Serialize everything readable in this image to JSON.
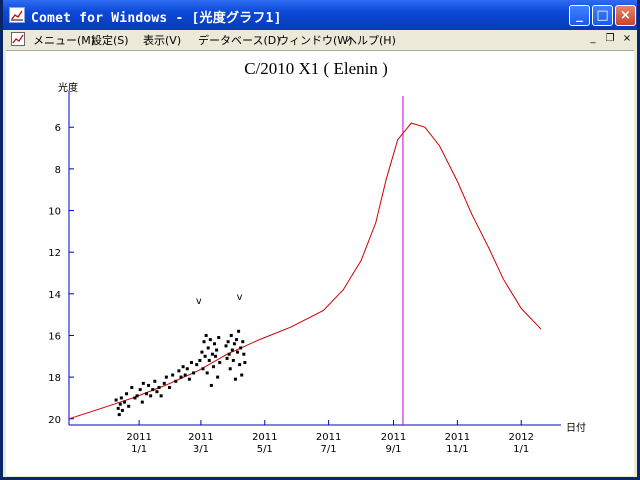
{
  "window": {
    "title": "Comet for Windows - [光度グラフ1]",
    "icon_name": "app-graph-icon",
    "minimize_icon": "minimize-icon",
    "maximize_icon": "maximize-icon",
    "close_icon": "close-icon"
  },
  "menu": {
    "items": [
      "メニュー(M)",
      "設定(S)",
      "表示(V)",
      "データベース(D)",
      "ウィンドウ(W)",
      "ヘルプ(H)"
    ]
  },
  "chart_data": {
    "type": "scatter",
    "title": "C/2010 X1 ( Elenin )",
    "ylabel": "光度",
    "xlabel": "日付",
    "y_ticks": [
      6,
      8,
      10,
      12,
      14,
      16,
      18,
      20
    ],
    "ylim": [
      20.3,
      4.5
    ],
    "y_inverted": true,
    "x_tick_labels": [
      {
        "date": "2011-01-01",
        "year": "2011",
        "md": "1/1"
      },
      {
        "date": "2011-03-01",
        "year": "2011",
        "md": "3/1"
      },
      {
        "date": "2011-05-01",
        "year": "2011",
        "md": "5/1"
      },
      {
        "date": "2011-07-01",
        "year": "2011",
        "md": "7/1"
      },
      {
        "date": "2011-09-01",
        "year": "2011",
        "md": "9/1"
      },
      {
        "date": "2011-11-01",
        "year": "2011",
        "md": "11/1"
      },
      {
        "date": "2012-01-01",
        "year": "2012",
        "md": "1/1"
      }
    ],
    "xlim": [
      "2010-10-26",
      "2012-02-08"
    ],
    "today_marker_date": "2011-09-10",
    "predicted_curve": {
      "color": "#cc0000",
      "points": [
        [
          "2010-10-26",
          20.0
        ],
        [
          "2010-11-26",
          19.5
        ],
        [
          "2010-12-26",
          19.0
        ],
        [
          "2011-01-26",
          18.4
        ],
        [
          "2011-02-26",
          17.7
        ],
        [
          "2011-03-26",
          16.9
        ],
        [
          "2011-04-26",
          16.2
        ],
        [
          "2011-05-26",
          15.6
        ],
        [
          "2011-06-26",
          14.8
        ],
        [
          "2011-07-15",
          13.8
        ],
        [
          "2011-08-01",
          12.4
        ],
        [
          "2011-08-15",
          10.6
        ],
        [
          "2011-08-25",
          8.5
        ],
        [
          "2011-09-05",
          6.6
        ],
        [
          "2011-09-18",
          5.8
        ],
        [
          "2011-10-01",
          6.0
        ],
        [
          "2011-10-15",
          6.9
        ],
        [
          "2011-11-01",
          8.6
        ],
        [
          "2011-11-15",
          10.2
        ],
        [
          "2011-12-01",
          11.8
        ],
        [
          "2011-12-15",
          13.3
        ],
        [
          "2012-01-01",
          14.7
        ],
        [
          "2012-01-20",
          15.7
        ]
      ]
    },
    "observations": [
      [
        "2010-12-10",
        19.1
      ],
      [
        "2010-12-12",
        19.5
      ],
      [
        "2010-12-13",
        19.8
      ],
      [
        "2010-12-14",
        19.3
      ],
      [
        "2010-12-15",
        19.0
      ],
      [
        "2010-12-16",
        19.6
      ],
      [
        "2010-12-18",
        19.2
      ],
      [
        "2010-12-20",
        18.8
      ],
      [
        "2010-12-22",
        19.4
      ],
      [
        "2010-12-25",
        18.5
      ],
      [
        "2010-12-28",
        19.0
      ],
      [
        "2010-12-30",
        18.9
      ],
      [
        "2011-01-02",
        18.6
      ],
      [
        "2011-01-04",
        19.2
      ],
      [
        "2011-01-05",
        18.3
      ],
      [
        "2011-01-08",
        18.8
      ],
      [
        "2011-01-10",
        18.4
      ],
      [
        "2011-01-12",
        18.9
      ],
      [
        "2011-01-14",
        18.6
      ],
      [
        "2011-01-16",
        18.2
      ],
      [
        "2011-01-18",
        18.7
      ],
      [
        "2011-01-20",
        18.5
      ],
      [
        "2011-01-22",
        18.9
      ],
      [
        "2011-01-25",
        18.3
      ],
      [
        "2011-01-27",
        18.0
      ],
      [
        "2011-01-30",
        18.5
      ],
      [
        "2011-02-02",
        17.9
      ],
      [
        "2011-02-05",
        18.2
      ],
      [
        "2011-02-08",
        17.7
      ],
      [
        "2011-02-10",
        18.0
      ],
      [
        "2011-02-12",
        17.5
      ],
      [
        "2011-02-14",
        17.9
      ],
      [
        "2011-02-16",
        17.6
      ],
      [
        "2011-02-18",
        18.1
      ],
      [
        "2011-02-20",
        17.3
      ],
      [
        "2011-02-22",
        17.8
      ],
      [
        "2011-02-25",
        17.4
      ],
      [
        "2011-02-28",
        17.2
      ],
      [
        "2011-03-02",
        16.8
      ],
      [
        "2011-03-03",
        17.6
      ],
      [
        "2011-03-04",
        16.3
      ],
      [
        "2011-03-05",
        17.0
      ],
      [
        "2011-03-06",
        16.0
      ],
      [
        "2011-03-07",
        17.8
      ],
      [
        "2011-03-08",
        16.6
      ],
      [
        "2011-03-09",
        17.2
      ],
      [
        "2011-03-10",
        16.2
      ],
      [
        "2011-03-11",
        18.4
      ],
      [
        "2011-03-12",
        16.9
      ],
      [
        "2011-03-13",
        17.5
      ],
      [
        "2011-03-14",
        16.4
      ],
      [
        "2011-03-15",
        17.0
      ],
      [
        "2011-03-16",
        16.7
      ],
      [
        "2011-03-17",
        18.0
      ],
      [
        "2011-03-18",
        16.1
      ],
      [
        "2011-03-19",
        17.3
      ],
      [
        "2011-03-25",
        16.5
      ],
      [
        "2011-03-26",
        17.1
      ],
      [
        "2011-03-27",
        16.3
      ],
      [
        "2011-03-28",
        16.9
      ],
      [
        "2011-03-29",
        17.6
      ],
      [
        "2011-03-30",
        16.0
      ],
      [
        "2011-03-31",
        16.7
      ],
      [
        "2011-04-01",
        17.2
      ],
      [
        "2011-04-02",
        16.4
      ],
      [
        "2011-04-03",
        18.1
      ],
      [
        "2011-04-04",
        16.2
      ],
      [
        "2011-04-05",
        16.8
      ],
      [
        "2011-04-06",
        15.8
      ],
      [
        "2011-04-07",
        17.4
      ],
      [
        "2011-04-08",
        16.6
      ],
      [
        "2011-04-09",
        17.9
      ],
      [
        "2011-04-10",
        16.3
      ],
      [
        "2011-04-11",
        16.9
      ],
      [
        "2011-04-12",
        17.3
      ]
    ],
    "upper_limits": [
      {
        "date": "2011-02-27",
        "mag": 14.5,
        "label": "v"
      },
      {
        "date": "2011-04-07",
        "mag": 14.3,
        "label": "v"
      }
    ]
  }
}
